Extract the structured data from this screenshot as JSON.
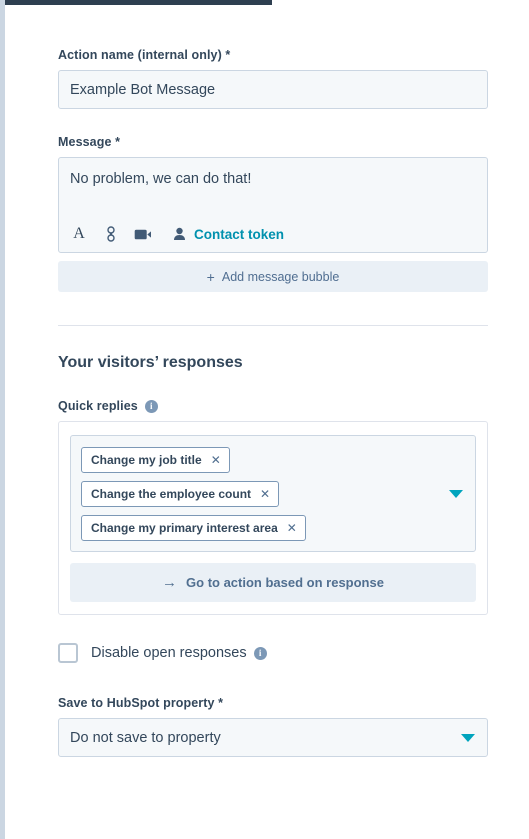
{
  "action_name": {
    "label": "Action name (internal only) *",
    "value": "Example Bot Message"
  },
  "message": {
    "label": "Message *",
    "value": "No problem, we can do that!",
    "toolbar": {
      "format_icon": "text-format-icon",
      "link_icon": "link-icon",
      "video_icon": "video-icon",
      "contact_icon": "contact-person-icon",
      "contact_token_label": "Contact token"
    },
    "add_bubble_label": "Add message bubble",
    "add_bubble_plus": "+"
  },
  "visitors": {
    "section_heading": "Your visitors’ responses",
    "quick_replies_label": "Quick replies",
    "info_glyph": "i",
    "tags": [
      {
        "label": "Change my job title",
        "remove": "✕"
      },
      {
        "label": "Change the employee count",
        "remove": "✕"
      },
      {
        "label": "Change my primary interest area",
        "remove": "✕"
      }
    ],
    "go_to_action_label": "Go to action based on response",
    "go_to_action_arrow": "→"
  },
  "disable_open_responses": {
    "label": "Disable open responses",
    "checked": false,
    "info_glyph": "i"
  },
  "save_property": {
    "label": "Save to HubSpot property *",
    "selected": "Do not save to property",
    "options": [
      "Do not save to property"
    ]
  },
  "colors": {
    "accent_teal": "#00a4bd",
    "link_teal": "#0091ae",
    "text_dark": "#33475b",
    "muted_blue": "#516f90",
    "field_bg": "#f5f8fa",
    "field_border": "#cbd6e2",
    "button_bg": "#eaf0f6",
    "topbar_dark": "#2e3f50"
  }
}
